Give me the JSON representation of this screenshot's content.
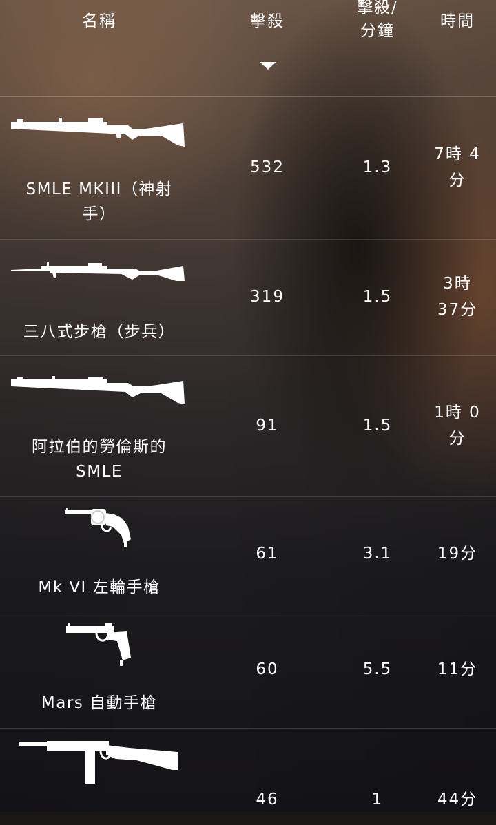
{
  "header": {
    "name_label": "名稱",
    "kills_label": "擊殺",
    "kpm_label_line1": "擊殺/",
    "kpm_label_line2": "分鐘",
    "time_label": "時間",
    "sort_icon": "caret-down-icon"
  },
  "weapons": [
    {
      "name": "SMLE MKIII（神射手）",
      "name_line1": "SMLE MKIII（神射",
      "name_line2": "手）",
      "kills": "532",
      "kpm": "1.3",
      "time_line1": "7時 4",
      "time_line2": "分",
      "icon": "rifle-scoped-icon"
    },
    {
      "name": "三八式步槍（步兵）",
      "kills": "319",
      "kpm": "1.5",
      "time_line1": "3時",
      "time_line2": "37分",
      "icon": "rifle-bayonet-icon"
    },
    {
      "name_line1": "阿拉伯的勞倫斯的",
      "name_line2": "SMLE",
      "kills": "91",
      "kpm": "1.5",
      "time_line1": "1時 0",
      "time_line2": "分",
      "icon": "rifle-icon"
    },
    {
      "name": "Mk VI 左輪手槍",
      "kills": "61",
      "kpm": "3.1",
      "time": "19分",
      "icon": "revolver-icon"
    },
    {
      "name": "Mars 自動手槍",
      "kills": "60",
      "kpm": "5.5",
      "time": "11分",
      "icon": "pistol-icon"
    },
    {
      "kills": "46",
      "kpm": "1",
      "time": "44分",
      "icon": "submachine-gun-icon"
    }
  ]
}
